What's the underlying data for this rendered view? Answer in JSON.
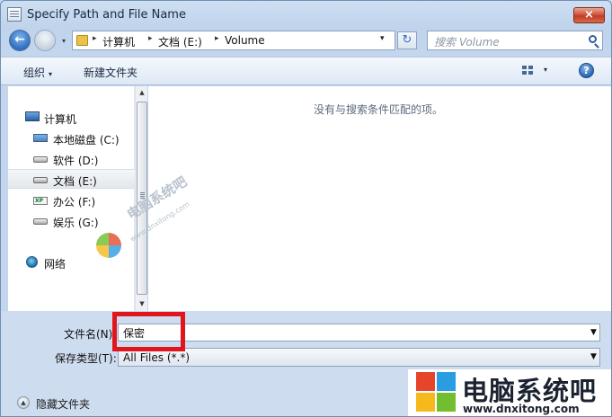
{
  "window": {
    "title": "Specify Path and File Name",
    "close_glyph": "×"
  },
  "nav": {
    "back_glyph": "←",
    "forward_glyph": "→",
    "dropdown_glyph": "▾",
    "breadcrumbs": [
      "计算机",
      "文档 (E:)",
      "Volume"
    ],
    "crumb_sep": "▸",
    "address_dropdown": "▾",
    "refresh_glyph": "↻",
    "search_placeholder": "搜索 Volume"
  },
  "toolbar": {
    "organize": "组织",
    "organize_arrow": "▾",
    "new_folder": "新建文件夹",
    "view_dropdown": "▾",
    "help": "?"
  },
  "tree": [
    {
      "label": "计算机",
      "icon": "computer-icon"
    },
    {
      "label": "本地磁盘 (C:)",
      "icon": "system-drive-icon"
    },
    {
      "label": "软件 (D:)",
      "icon": "drive-icon"
    },
    {
      "label": "文档 (E:)",
      "icon": "drive-icon",
      "selected": true
    },
    {
      "label": "办公 (F:)",
      "icon": "xp-drive-icon"
    },
    {
      "label": "娱乐 (G:)",
      "icon": "drive-icon"
    },
    {
      "label": "网络",
      "icon": "network-icon"
    }
  ],
  "scroll": {
    "up": "▲",
    "down": "▼"
  },
  "content": {
    "empty_message": "没有与搜索条件匹配的项。"
  },
  "watermark": {
    "text": "电脑系统吧",
    "sub": "www.dnxitong.com"
  },
  "form": {
    "filename_label": "文件名(N):",
    "filename_value": "保密",
    "filetype_label": "保存类型(T):",
    "filetype_value": "All Files (*.*)",
    "combo_arrow": "▼",
    "hide_folders": "隐藏文件夹",
    "hide_glyph": "▲"
  },
  "brand": {
    "name": "电脑系统吧",
    "url": "www.dnxitong.com"
  },
  "colors": {
    "highlight": "#e0161c",
    "accent": "#2f6fc0"
  }
}
